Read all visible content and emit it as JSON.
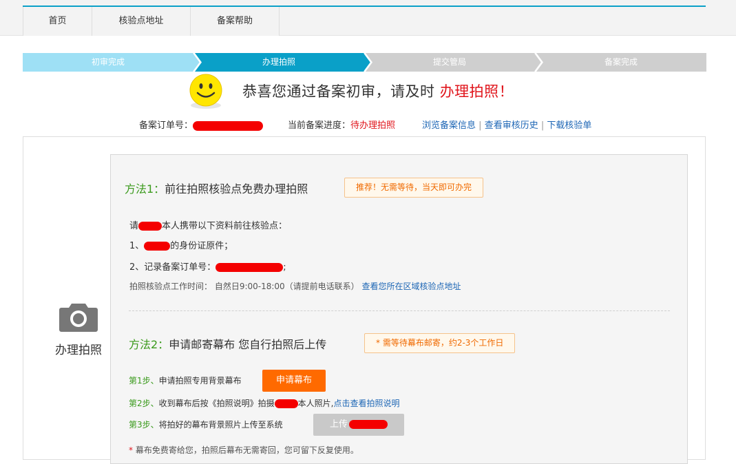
{
  "nav": {
    "items": [
      {
        "label": "首页"
      },
      {
        "label": "核验点地址"
      },
      {
        "label": "备案帮助"
      }
    ]
  },
  "steps": [
    {
      "label": "初审完成",
      "state": "done",
      "color": "#9ee0f5"
    },
    {
      "label": "办理拍照",
      "state": "current",
      "color": "#0aa0c8"
    },
    {
      "label": "提交管局",
      "state": "todo",
      "color": "#cfcfcf"
    },
    {
      "label": "备案完成",
      "state": "todo",
      "color": "#cfcfcf"
    }
  ],
  "congrats": {
    "text": "恭喜您通过备案初审，请及时",
    "highlight": "办理拍照！"
  },
  "info": {
    "order_label": "备案订单号：",
    "progress_label": "当前备案进度：",
    "progress_value": "待办理拍照",
    "links": [
      "浏览备案信息",
      "查看审核历史",
      "下载核验单"
    ],
    "separator": "|"
  },
  "side": {
    "label": "办理拍照",
    "icon": "camera-icon"
  },
  "method1": {
    "prefix": "方法1：",
    "title": "前往拍照核验点免费办理拍照",
    "badge": "推荐！无需等待，当天即可办完",
    "line1_a": "请",
    "line1_b": "本人携带以下资料前往核验点：",
    "line2_a": "1、",
    "line2_b": "的身份证原件；",
    "line3_a": "2、记录备案订单号：",
    "line3_b": ";",
    "hours": "拍照核验点工作时间： 自然日9:00-18:00（请提前电话联系）",
    "hours_link": "查看您所在区域核验点地址"
  },
  "method2": {
    "prefix": "方法2：",
    "title": "申请邮寄幕布 您自行拍照后上传",
    "badge": "* 需等待幕布邮寄，约2-3个工作日",
    "step1_prefix": "第1步、",
    "step1_text": "申请拍照专用背景幕布",
    "step1_button": "申请幕布",
    "step2_prefix": "第2步、",
    "step2_text_a": "收到幕布后按《拍照说明》拍摄",
    "step2_text_b": "本人照片,",
    "step2_link": "点击查看拍照说明",
    "step3_prefix": "第3步、",
    "step3_text": "将拍好的幕布背景照片上传至系统",
    "step3_button": "上传",
    "footnote_star": "*",
    "footnote": "幕布免费寄给您，拍照后幕布无需寄回，您可留下反复使用。"
  }
}
